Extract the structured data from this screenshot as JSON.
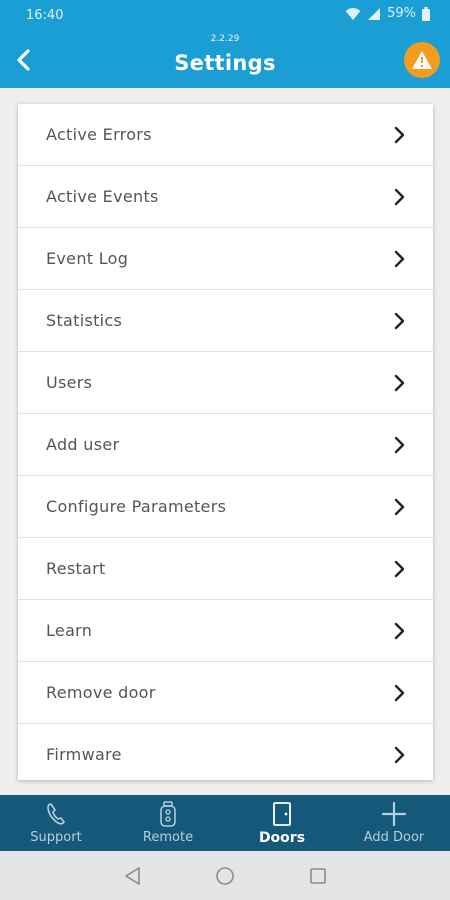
{
  "status": {
    "time": "16:40",
    "battery": "59%"
  },
  "header": {
    "version": "2.2.29",
    "title": "Settings"
  },
  "menu": [
    {
      "label": "Active Errors"
    },
    {
      "label": "Active Events"
    },
    {
      "label": "Event Log"
    },
    {
      "label": "Statistics"
    },
    {
      "label": "Users"
    },
    {
      "label": "Add user"
    },
    {
      "label": "Configure Parameters"
    },
    {
      "label": "Restart"
    },
    {
      "label": "Learn"
    },
    {
      "label": "Remove door"
    },
    {
      "label": "Firmware"
    }
  ],
  "tabs": [
    {
      "label": "Support",
      "icon": "phone-icon"
    },
    {
      "label": "Remote",
      "icon": "remote-icon"
    },
    {
      "label": "Doors",
      "icon": "door-icon",
      "active": true
    },
    {
      "label": "Add Door",
      "icon": "plus-icon"
    }
  ],
  "colors": {
    "primary": "#1b9ed4",
    "tabbar": "#15587a",
    "alert": "#f39c1f"
  }
}
